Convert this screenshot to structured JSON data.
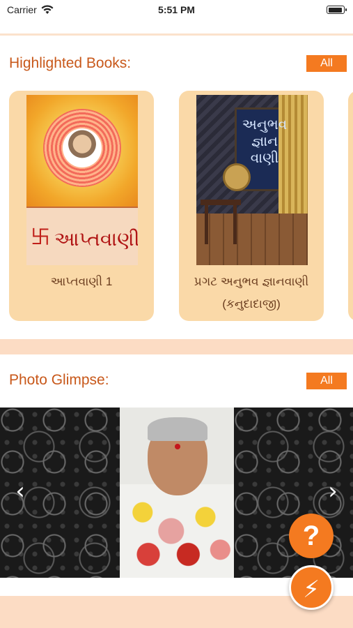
{
  "status_bar": {
    "carrier": "Carrier",
    "time": "5:51 PM",
    "wifi_icon": "wifi-icon",
    "battery_icon": "battery-icon"
  },
  "highlighted_books": {
    "title": "Highlighted Books:",
    "all_label": "All",
    "books": [
      {
        "title": "આપ્તવાણી 1",
        "cover_text": "આપ્તવાણી-૧",
        "cover_symbol": "卐"
      },
      {
        "title_line1": "પ્રગટ અનુભવ જ્ઞાનવાણી",
        "title_line2": "(કનુદાદાજી)",
        "cover_heading_line1": "અનુભવ",
        "cover_heading_line2": "જ્ઞાન",
        "cover_heading_line3": "વાણી"
      }
    ]
  },
  "photo_glimpse": {
    "title": "Photo Glimpse:",
    "all_label": "All",
    "prev_icon": "‹",
    "next_icon": "›"
  },
  "fabs": {
    "help_icon": "?",
    "bolt_icon": "⚡"
  },
  "colors": {
    "accent": "#f47a20",
    "heading": "#c8581a",
    "card": "#fad9a8",
    "band": "#fcdcc4"
  }
}
